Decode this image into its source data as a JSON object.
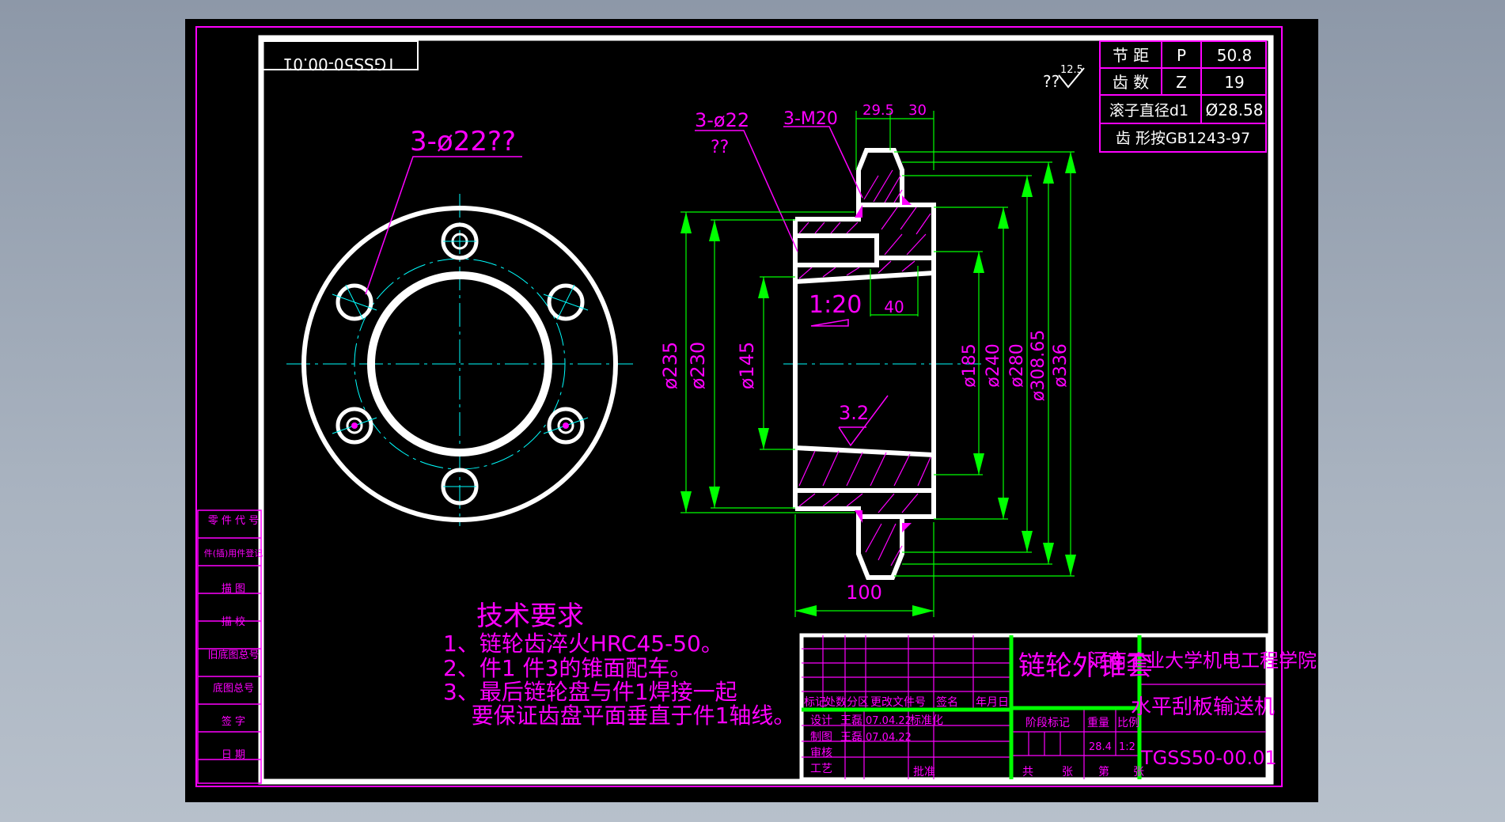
{
  "drawing_number_rotated": "TGSS50-00.01",
  "sprocket_table": [
    {
      "name": "节 距",
      "symbol": "P",
      "value": "50.8"
    },
    {
      "name": "齿 数",
      "symbol": "Z",
      "value": "19"
    },
    {
      "name": "滚子直径d1",
      "symbol": "",
      "value": "Ø28.58"
    },
    {
      "name": "齿  形按GB1243-97",
      "symbol": "",
      "value": ""
    }
  ],
  "roughness_mark": {
    "prefix": "??",
    "value": "12.5"
  },
  "front_view": {
    "hole_callout": "3-ø22??"
  },
  "section_view": {
    "callout_hole": "3-ø22",
    "callout_hole_sub": "??",
    "callout_thread": "3-M20",
    "dim_top_1": "29.5",
    "dim_top_2": "30",
    "taper": "1:20",
    "dim_40": "40",
    "roughness": "3.2",
    "dim_bottom": "100",
    "dims_left": [
      "ø235",
      "ø230",
      "ø145"
    ],
    "dims_right": [
      "ø185",
      "ø240",
      "ø280",
      "ø308.65",
      "ø336"
    ]
  },
  "tech_req": {
    "title": "技术要求",
    "lines": [
      "1、链轮齿淬火HRC45-50。",
      "2、件1 件3的锥面配车。",
      "3、最后链轮盘与件1焊接一起",
      "    要保证齿盘平面垂直于件1轴线。"
    ]
  },
  "left_strip": [
    "零 件 代 号",
    "件(插)用件登记",
    "描 图",
    "描 校",
    "旧底图总号",
    "底图总号",
    "签 字",
    "日 期"
  ],
  "title_block": {
    "part_name": "链轮外锥套",
    "school": "河南工业大学机电工程学院",
    "machine": "水平刮板输送机",
    "drawing_number": "TGSS50-00.01",
    "revision_row": [
      "标记",
      "处数",
      "分区",
      "更改文件号",
      "签名",
      "年月日"
    ],
    "design_label": "设计",
    "design_name": "王磊",
    "design_date": "07.04.22",
    "std_label": "标准化",
    "draw_label": "制图",
    "draw_name": "王磊",
    "draw_date": "07.04.22",
    "review_label": "审核",
    "process_label": "工艺",
    "approve_label": "批准",
    "stage_label": "阶段标记",
    "weight_label": "重量",
    "scale_label": "比例",
    "weight": "28.4",
    "scale": "1:2",
    "total_label": "共",
    "sheet_label": "张",
    "page_label": "第",
    "page_unit": "张"
  },
  "colors": {
    "frame": "#ffffff",
    "magenta": "#ff00ff",
    "green": "#00ff00",
    "cyan": "#00ffff",
    "background": "#000000"
  }
}
